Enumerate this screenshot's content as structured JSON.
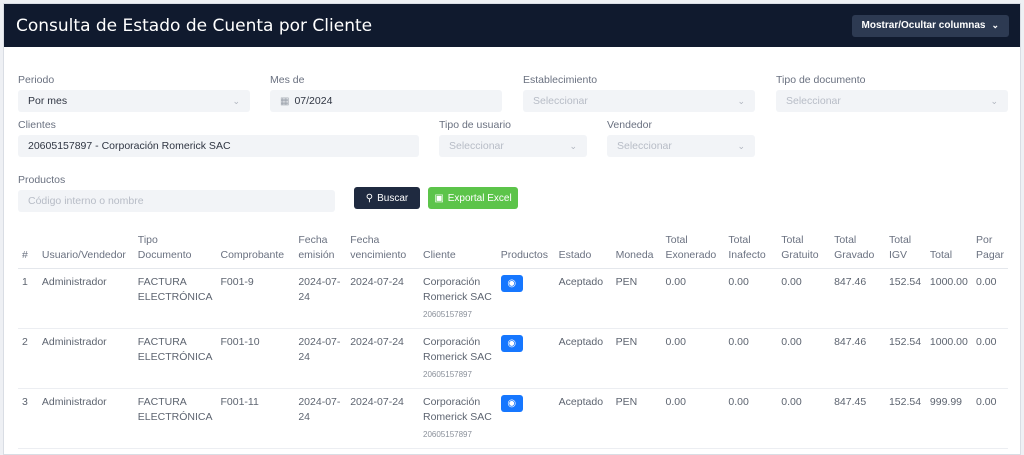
{
  "header": {
    "title": "Consulta de Estado de Cuenta por Cliente",
    "columns_button": "Mostrar/Ocultar columnas"
  },
  "filters": {
    "periodo": {
      "label": "Periodo",
      "value": "Por mes"
    },
    "mes": {
      "label": "Mes de",
      "value": "07/2024"
    },
    "establecimiento": {
      "label": "Establecimiento",
      "placeholder": "Seleccionar"
    },
    "tipo_documento": {
      "label": "Tipo de documento",
      "placeholder": "Seleccionar"
    },
    "clientes": {
      "label": "Clientes",
      "value": "20605157897 - Corporación Romerick SAC"
    },
    "tipo_usuario": {
      "label": "Tipo de usuario",
      "placeholder": "Seleccionar"
    },
    "vendedor": {
      "label": "Vendedor",
      "placeholder": "Seleccionar"
    },
    "productos": {
      "label": "Productos",
      "placeholder": "Código interno o nombre"
    },
    "buscar_label": "Buscar",
    "excel_label": "Exportal Excel"
  },
  "table": {
    "headers": [
      "#",
      "Usuario/Vendedor",
      "Tipo Documento",
      "Comprobante",
      "Fecha emisión",
      "Fecha vencimiento",
      "Cliente",
      "Productos",
      "Estado",
      "Moneda",
      "Total Exonerado",
      "Total Inafecto",
      "Total Gratuito",
      "Total Gravado",
      "Total IGV",
      "Total",
      "Por Pagar"
    ],
    "rows": [
      {
        "n": "1",
        "user": "Administrador",
        "tipo": "FACTURA ELECTRÓNICA",
        "comp": "F001-9",
        "emision": "2024-07-24",
        "venc": "2024-07-24",
        "cliente": "Corporación Romerick SAC",
        "ruc": "20605157897",
        "estado": "Aceptado",
        "moneda": "PEN",
        "exo": "0.00",
        "inaf": "0.00",
        "grat": "0.00",
        "grav": "847.46",
        "igv": "152.54",
        "total": "1000.00",
        "pagar": "0.00"
      },
      {
        "n": "2",
        "user": "Administrador",
        "tipo": "FACTURA ELECTRÓNICA",
        "comp": "F001-10",
        "emision": "2024-07-24",
        "venc": "2024-07-24",
        "cliente": "Corporación Romerick SAC",
        "ruc": "20605157897",
        "estado": "Aceptado",
        "moneda": "PEN",
        "exo": "0.00",
        "inaf": "0.00",
        "grat": "0.00",
        "grav": "847.46",
        "igv": "152.54",
        "total": "1000.00",
        "pagar": "0.00"
      },
      {
        "n": "3",
        "user": "Administrador",
        "tipo": "FACTURA ELECTRÓNICA",
        "comp": "F001-11",
        "emision": "2024-07-24",
        "venc": "2024-07-24",
        "cliente": "Corporación Romerick SAC",
        "ruc": "20605157897",
        "estado": "Aceptado",
        "moneda": "PEN",
        "exo": "0.00",
        "inaf": "0.00",
        "grat": "0.00",
        "grav": "847.45",
        "igv": "152.54",
        "total": "999.99",
        "pagar": "0.00"
      }
    ]
  }
}
